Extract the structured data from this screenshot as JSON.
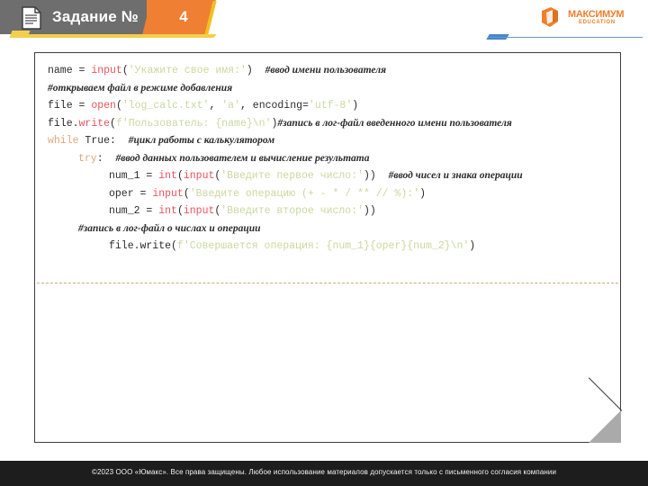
{
  "header": {
    "title": "Задание №",
    "number": "4",
    "doc_icon": "document-icon",
    "logo_text": "МАКСИМУМ",
    "logo_sub": "EDUCATION",
    "logo_icon": "maximum-logo-mark",
    "colors": {
      "gray": "#6e6e6e",
      "orange": "#ef7f32",
      "gold": "#f3cf4b",
      "blue_rule": "#5b9bd5",
      "logo_orange": "#f07f2a"
    }
  },
  "code_panel": {
    "language": "python",
    "colors": {
      "keyword": "#e0a878",
      "function": "#e8545d",
      "string": "#c9d9a0",
      "plain": "#2b2b2b",
      "comment": "#2b2b2b",
      "divider": "#c9ad7a",
      "border": "#3e3e3e",
      "fold": "#aaaaaa"
    },
    "lines": [
      {
        "indent": 0,
        "tokens": [
          {
            "t": "name ",
            "c": "plain"
          },
          {
            "t": "= ",
            "c": "plain"
          },
          {
            "t": "input",
            "c": "fn"
          },
          {
            "t": "(",
            "c": "plain"
          },
          {
            "t": "'Укажите свое имя:'",
            "c": "str"
          },
          {
            "t": ")  ",
            "c": "plain"
          },
          {
            "t": "#ввод имени пользователя",
            "c": "comment"
          }
        ]
      },
      {
        "indent": 0,
        "tokens": [
          {
            "t": "#открываем файл в режиме добавления",
            "c": "comment"
          }
        ]
      },
      {
        "indent": 0,
        "tokens": [
          {
            "t": "file ",
            "c": "plain"
          },
          {
            "t": "= ",
            "c": "plain"
          },
          {
            "t": "open",
            "c": "fn"
          },
          {
            "t": "(",
            "c": "plain"
          },
          {
            "t": "'log_calc.txt'",
            "c": "str"
          },
          {
            "t": ", ",
            "c": "plain"
          },
          {
            "t": "'a'",
            "c": "str"
          },
          {
            "t": ", encoding=",
            "c": "plain"
          },
          {
            "t": "'utf-8'",
            "c": "str"
          },
          {
            "t": ")",
            "c": "plain"
          }
        ]
      },
      {
        "indent": 0,
        "tokens": [
          {
            "t": "file.",
            "c": "plain"
          },
          {
            "t": "write",
            "c": "fn"
          },
          {
            "t": "(",
            "c": "plain"
          },
          {
            "t": "f'Пользователь: {name}\\n'",
            "c": "str"
          },
          {
            "t": ")",
            "c": "plain"
          },
          {
            "t": "#запись в лог-файл введенного имени пользователя",
            "c": "comment"
          }
        ]
      },
      {
        "indent": 0,
        "tokens": [
          {
            "t": "while ",
            "c": "kw"
          },
          {
            "t": "True",
            "c": "plain"
          },
          {
            "t": ":  ",
            "c": "plain"
          },
          {
            "t": "#цикл работы с калькулятором",
            "c": "comment"
          }
        ]
      },
      {
        "indent": 1,
        "tokens": [
          {
            "t": "try",
            "c": "kw"
          },
          {
            "t": ":  ",
            "c": "plain"
          },
          {
            "t": "#ввод данных пользователем и вычисление результата",
            "c": "comment"
          }
        ]
      },
      {
        "indent": 2,
        "tokens": [
          {
            "t": "num_1 ",
            "c": "plain"
          },
          {
            "t": "= ",
            "c": "plain"
          },
          {
            "t": "int",
            "c": "fn"
          },
          {
            "t": "(",
            "c": "plain"
          },
          {
            "t": "input",
            "c": "fn"
          },
          {
            "t": "(",
            "c": "plain"
          },
          {
            "t": "'Введите первое число:'",
            "c": "str"
          },
          {
            "t": "))  ",
            "c": "plain"
          },
          {
            "t": "#ввод чисел и знака операции",
            "c": "comment"
          }
        ]
      },
      {
        "indent": 2,
        "tokens": [
          {
            "t": "oper ",
            "c": "plain"
          },
          {
            "t": "= ",
            "c": "plain"
          },
          {
            "t": "input",
            "c": "fn"
          },
          {
            "t": "(",
            "c": "plain"
          },
          {
            "t": "'Введите операцию (+ - * / ** // %):'",
            "c": "str"
          },
          {
            "t": ")",
            "c": "plain"
          }
        ]
      },
      {
        "indent": 2,
        "tokens": [
          {
            "t": "num_2 ",
            "c": "plain"
          },
          {
            "t": "= ",
            "c": "plain"
          },
          {
            "t": "int",
            "c": "fn"
          },
          {
            "t": "(",
            "c": "plain"
          },
          {
            "t": "input",
            "c": "fn"
          },
          {
            "t": "(",
            "c": "plain"
          },
          {
            "t": "'Введите второе число:'",
            "c": "str"
          },
          {
            "t": "))",
            "c": "plain"
          }
        ]
      },
      {
        "indent": 1,
        "tokens": [
          {
            "t": "#запись в лог-файл о числах и операции",
            "c": "comment"
          }
        ]
      },
      {
        "indent": 2,
        "tokens": [
          {
            "t": "file.write(",
            "c": "plain"
          },
          {
            "t": "f'Совершается операция: {num_1}{oper}{num_2}\\n'",
            "c": "str"
          },
          {
            "t": ")",
            "c": "plain"
          }
        ]
      }
    ]
  },
  "footer": {
    "text": "©2023 ООО «Юмакс». Все права защищены. Любое использование материалов допускается только с  письменного согласия компании"
  }
}
